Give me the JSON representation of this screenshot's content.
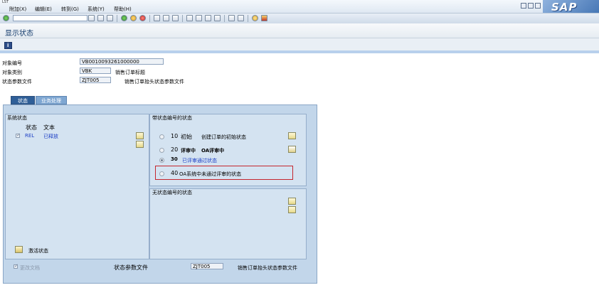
{
  "window": {
    "menu_label": "LST",
    "menus": [
      "附加(X)",
      "编辑(E)",
      "转到(G)",
      "系统(Y)",
      "帮助(H)"
    ],
    "sap_logo": "SAP"
  },
  "title": "显示状态",
  "header": {
    "object_number_label": "对象编号",
    "object_number_value": "VB0010093261000000",
    "object_category_label": "对象类别",
    "object_category_value": "VBK",
    "object_category_desc": "销售订单标题",
    "status_profile_label": "状态参数文件",
    "status_profile_value": "ZJT005",
    "status_profile_desc": "销售订单抬头状态参数文件"
  },
  "tabs": [
    {
      "label": "状态",
      "active": true
    },
    {
      "label": "业务处理",
      "active": false
    }
  ],
  "system_status": {
    "title": "系统状态",
    "col_status": "状态",
    "col_text": "文本",
    "rows": [
      {
        "code": "REL",
        "text": "已释放",
        "checked": true
      }
    ],
    "activate_label": "激活状态"
  },
  "status_with_number": {
    "title": "带状态编号的状态",
    "rows": [
      {
        "num": "10",
        "code": "初始",
        "text": "创建订单的初始状态",
        "selected": false
      },
      {
        "num": "20",
        "code": "评审中",
        "text": "OA评审中",
        "selected": false
      },
      {
        "num": "30",
        "code": "",
        "text": "已评审通过状态",
        "selected": true
      },
      {
        "num": "40",
        "code": "",
        "text": "OA系统中未通过评审的状态",
        "selected": false
      }
    ]
  },
  "status_without_number": {
    "title": "无状态编号的状态"
  },
  "footer": {
    "change_docs_label": "更改文档",
    "profile_label": "状态参数文件",
    "profile_value": "ZJT005",
    "profile_desc": "销售订单抬头状态参数文件"
  },
  "colors": {
    "accent": "#2f5f98",
    "highlight": "#c4262e",
    "panel": "#c2d6ea"
  }
}
